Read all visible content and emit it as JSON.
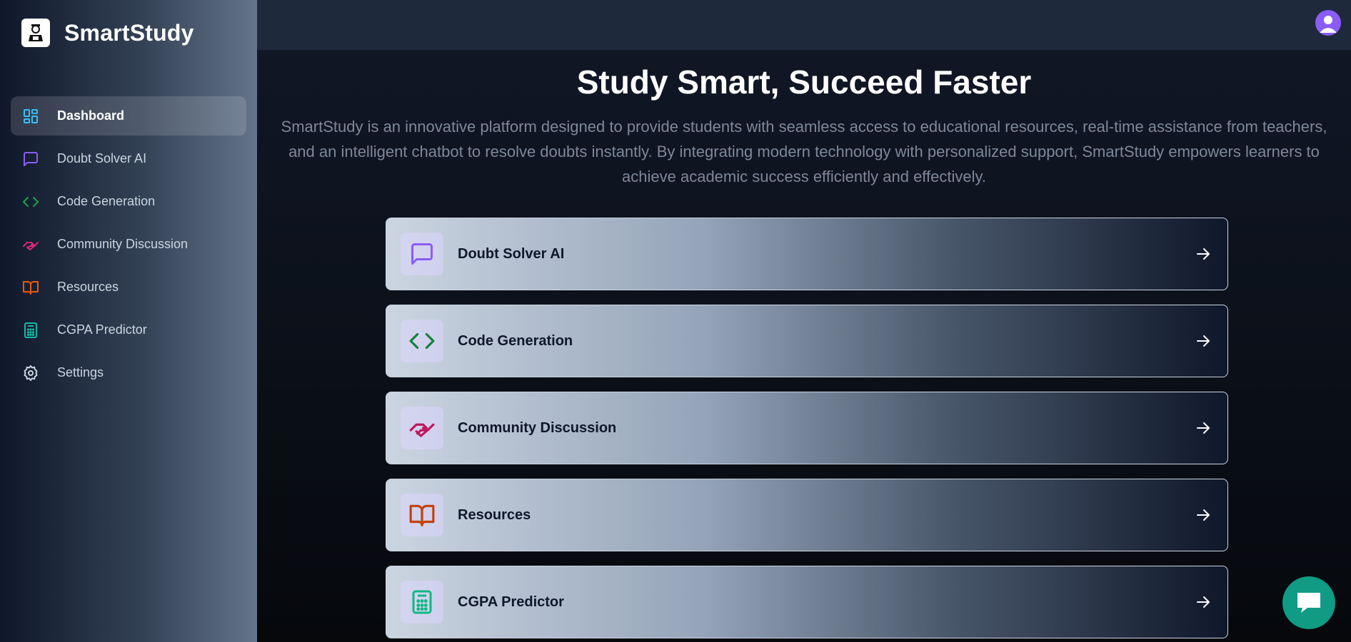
{
  "brand": {
    "name": "SmartStudy",
    "logo_icon": "graduate-icon"
  },
  "sidebar": {
    "items": [
      {
        "label": "Dashboard",
        "icon": "dashboard-icon",
        "color": "#38bdf8",
        "active": true
      },
      {
        "label": "Doubt Solver AI",
        "icon": "message-square-icon",
        "color": "#8b5cf6"
      },
      {
        "label": "Code Generation",
        "icon": "code-icon",
        "color": "#16a34a"
      },
      {
        "label": "Community Discussion",
        "icon": "handshake-icon",
        "color": "#db2777"
      },
      {
        "label": "Resources",
        "icon": "book-open-icon",
        "color": "#ea580c"
      },
      {
        "label": "CGPA Predictor",
        "icon": "calculator-icon",
        "color": "#14b8a6"
      },
      {
        "label": "Settings",
        "icon": "gear-icon",
        "color": "#cbd5e1"
      }
    ]
  },
  "header": {
    "avatar_icon": "user-avatar-icon",
    "avatar_color": "#8b5cf6"
  },
  "hero": {
    "title": "Study Smart, Succeed Faster",
    "description": "SmartStudy is an innovative platform designed to provide students with seamless access to educational resources, real-time assistance from teachers, and an intelligent chatbot to resolve doubts instantly. By integrating modern technology with personalized support, SmartStudy empowers learners to achieve academic success efficiently and effectively."
  },
  "cards": [
    {
      "label": "Doubt Solver AI",
      "icon": "message-square-icon",
      "color": "#8b5cf6"
    },
    {
      "label": "Code Generation",
      "icon": "code-icon",
      "color": "#15803d"
    },
    {
      "label": "Community Discussion",
      "icon": "handshake-icon",
      "color": "#be185d"
    },
    {
      "label": "Resources",
      "icon": "book-open-icon",
      "color": "#c2410c"
    },
    {
      "label": "CGPA Predictor",
      "icon": "calculator-icon",
      "color": "#10b981"
    }
  ],
  "chat_fab": {
    "icon": "chat-bubble-icon",
    "color": "#0f9b84"
  }
}
